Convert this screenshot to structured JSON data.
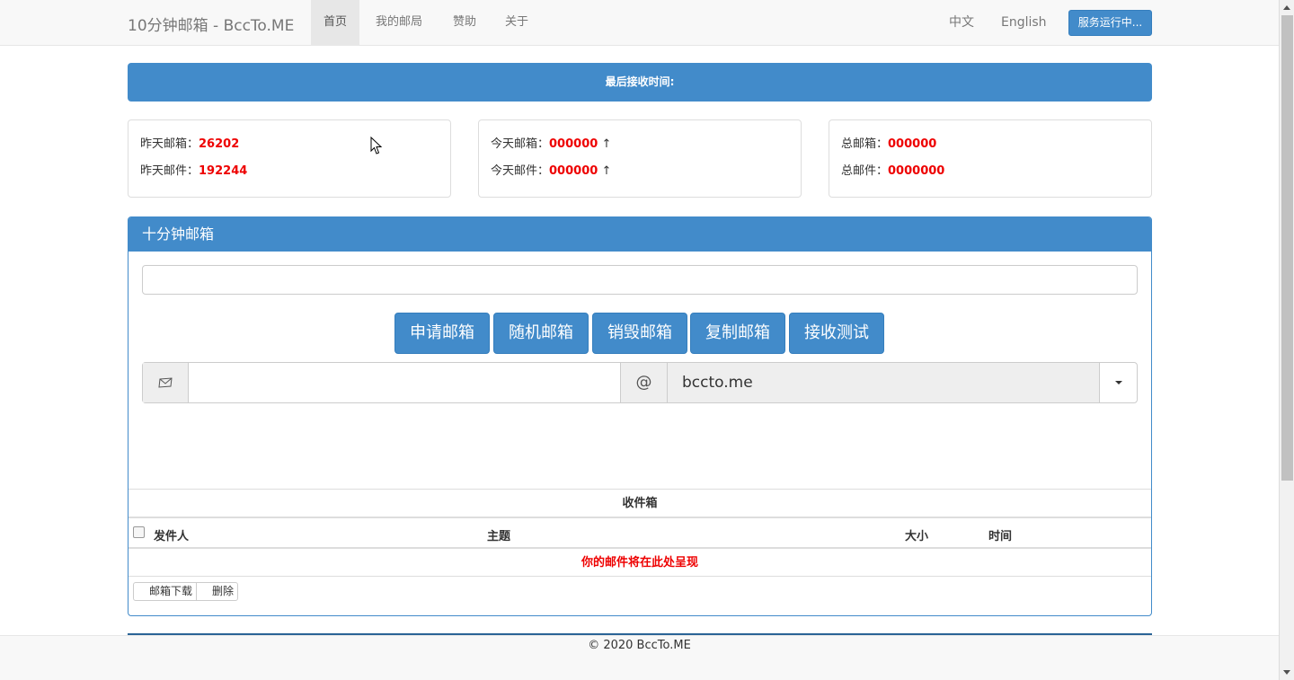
{
  "navbar": {
    "brand": "10分钟邮箱 - BccTo.ME",
    "items": [
      {
        "label": "首页",
        "active": true
      },
      {
        "label": "我的邮局",
        "active": false
      },
      {
        "label": "赞助",
        "active": false
      },
      {
        "label": "关于",
        "active": false
      }
    ],
    "lang_zh": "中文",
    "lang_en": "English",
    "status_button": "服务运行中..."
  },
  "last_received": {
    "label": "最后接收时间:"
  },
  "stats": {
    "yesterday_mailbox_label": "昨天邮箱：",
    "yesterday_mailbox_value": "26202",
    "yesterday_mail_label": "昨天邮件：",
    "yesterday_mail_value": "192244",
    "today_mailbox_label": "今天邮箱：",
    "today_mailbox_value": "000000",
    "today_mail_label": "今天邮件：",
    "today_mail_value": "000000",
    "trend_arrow": "↑",
    "total_mailbox_label": "总邮箱：",
    "total_mailbox_value": "000000",
    "total_mail_label": "总邮件：",
    "total_mail_value": "0000000"
  },
  "panel": {
    "title": "十分钟邮箱",
    "input_value": "",
    "buttons": [
      "申请邮箱",
      "随机邮箱",
      "销毁邮箱",
      "复制邮箱",
      "接收测试"
    ],
    "mail_icon": "envelope-icon",
    "username_value": "",
    "at_sign": "@",
    "domain": "bccto.me"
  },
  "inbox": {
    "title": "收件箱",
    "columns": {
      "sender": "发件人",
      "subject": "主题",
      "size": "大小",
      "time": "时间"
    },
    "empty_message": "你的邮件将在此处呈现",
    "download_button": "邮箱下载",
    "delete_button": "删除"
  },
  "footer": {
    "copyright": "© 2020 BccTo.ME"
  },
  "colors": {
    "primary": "#428bca",
    "highlight_red": "#ee0000"
  }
}
